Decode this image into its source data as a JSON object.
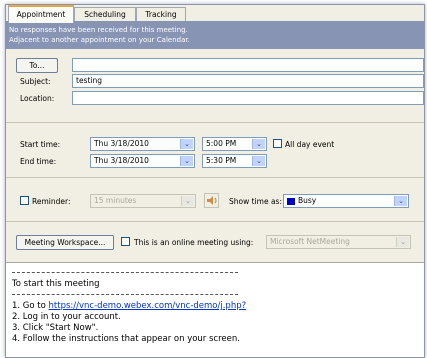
{
  "tabs": [
    "Appointment",
    "Scheduling",
    "Tracking"
  ],
  "banner": {
    "line1": "No responses have been received for this meeting.",
    "line2": "Adjacent to another appointment on your Calendar."
  },
  "to_button": "To...",
  "to_value": "",
  "subject_label": "Subject:",
  "subject_value": "testing",
  "location_label": "Location:",
  "location_value": "",
  "start_label": "Start time:",
  "start_date": "Thu 3/18/2010",
  "start_time": "5:00 PM",
  "allday_label": "All day event",
  "end_label": "End time:",
  "end_date": "Thu 3/18/2010",
  "end_time": "5:30 PM",
  "reminder_label": "Reminder:",
  "reminder_value": "15 minutes",
  "showtime_label": "Show time as:",
  "showtime_value": "Busy",
  "busy_color": "#0000c0",
  "workspace_button": "Meeting Workspace...",
  "online_label": "This is an online meeting using:",
  "online_value": "Microsoft NetMeeting",
  "notes": {
    "dashes": "----------------------------------------------------------",
    "heading": "To start this meeting",
    "step1_prefix": "1. Go to ",
    "step1_link": "https://vnc-demo.webex.com/vnc-demo/j.php?",
    "step2": "2. Log in to your account.",
    "step3": "3. Click \"Start Now\".",
    "step4": "4. Follow the instructions that appear on your screen."
  }
}
